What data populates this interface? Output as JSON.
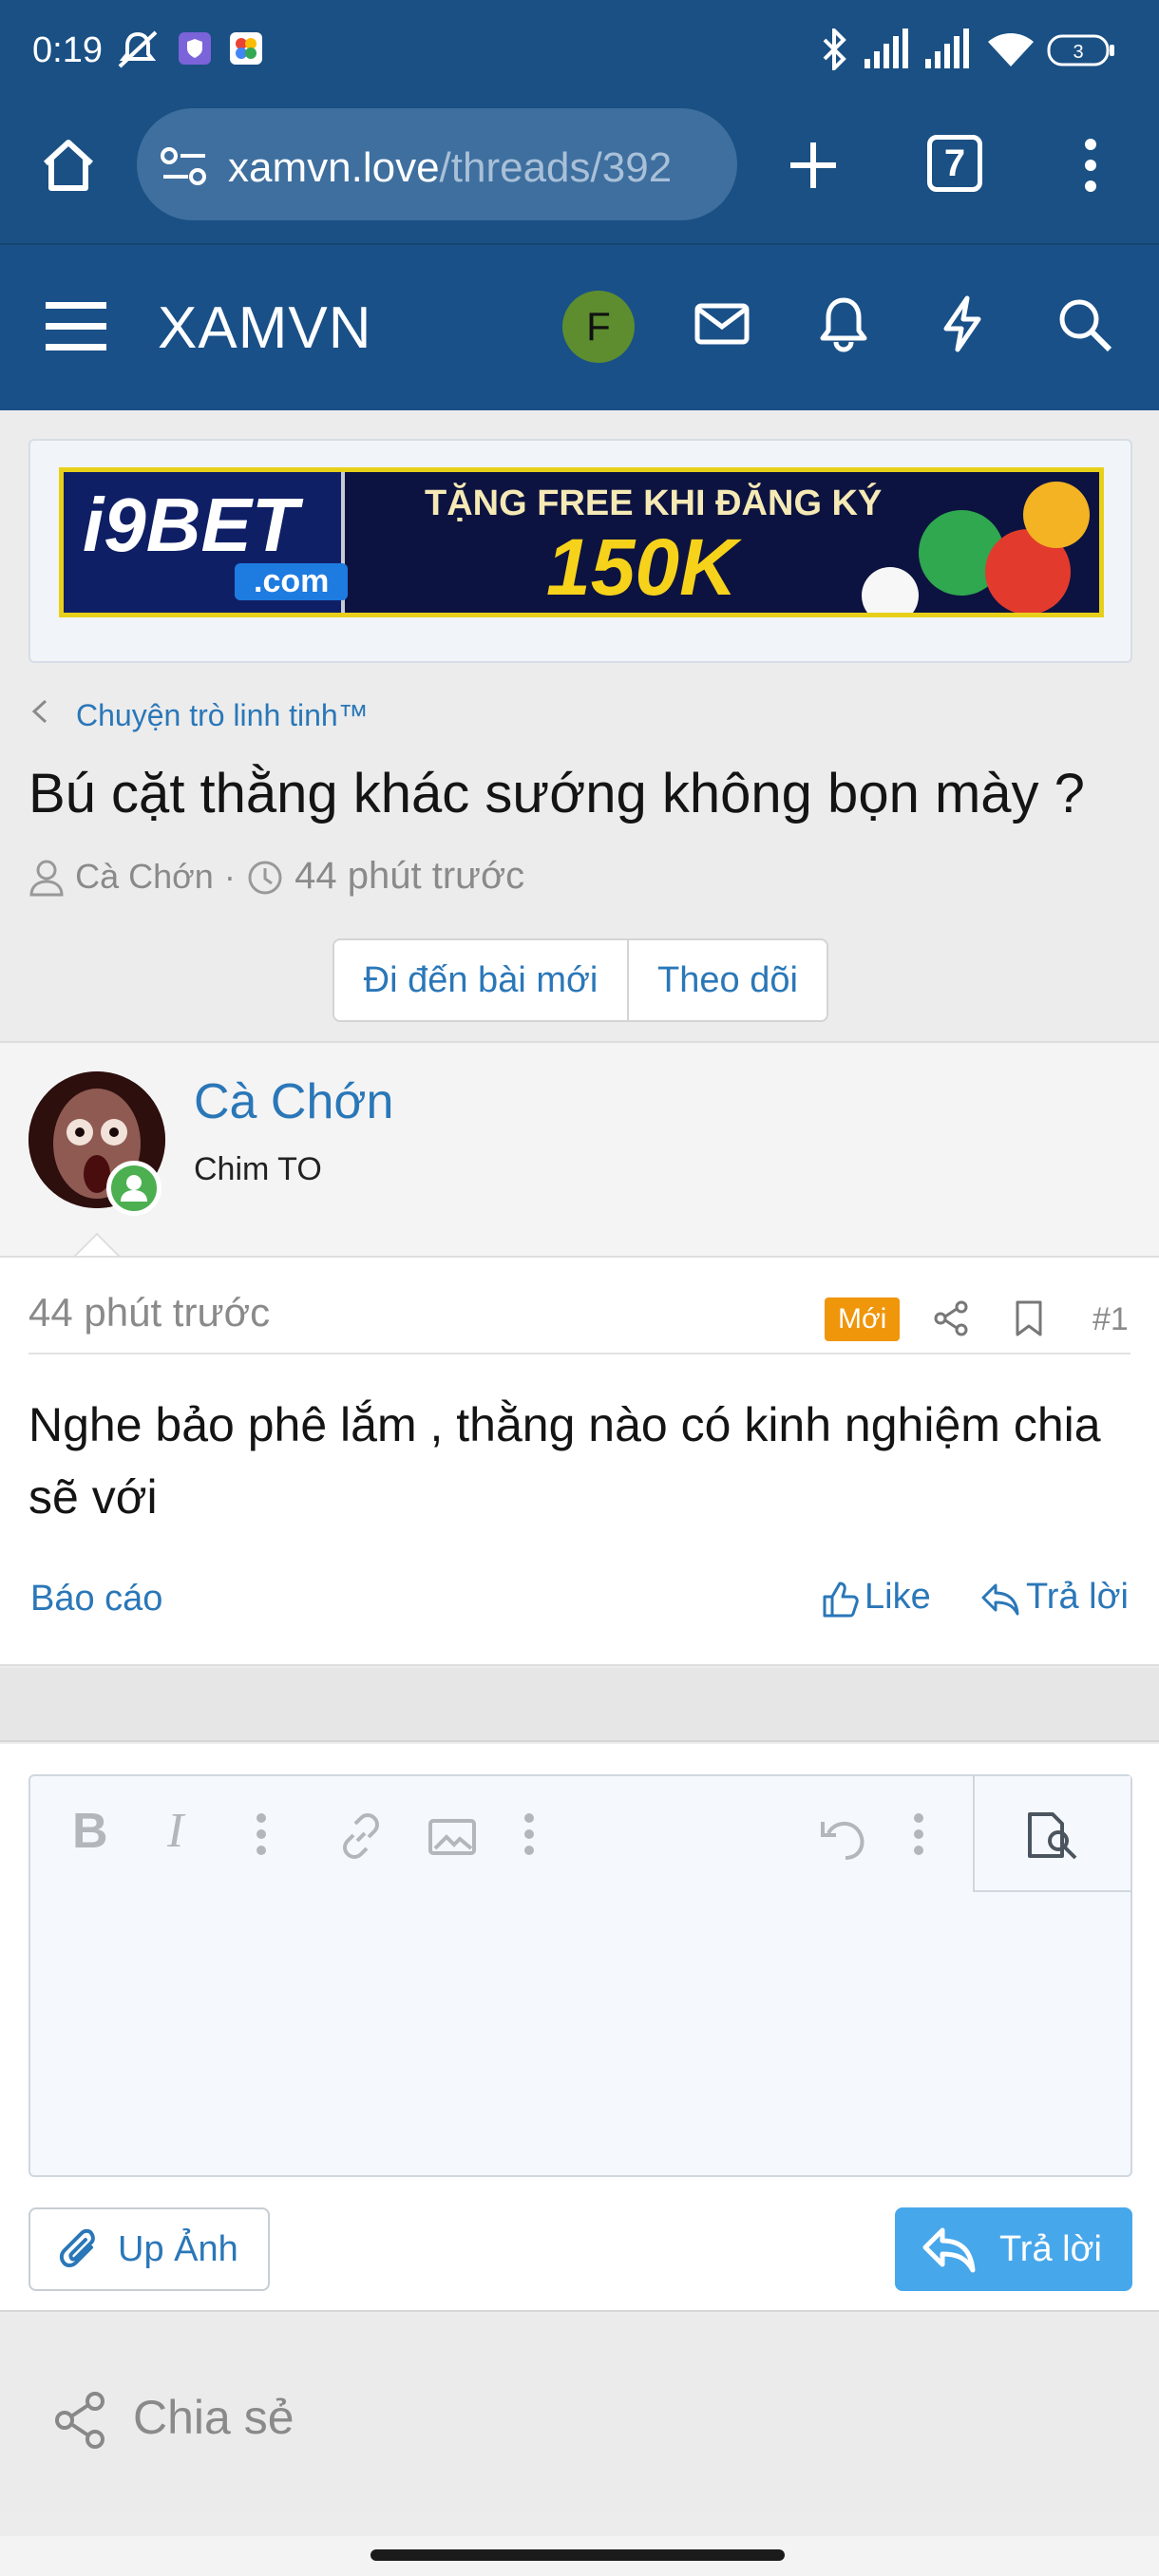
{
  "status_bar": {
    "time": "0:19",
    "battery": "3",
    "icons": [
      "notifications-off-icon",
      "shield-app-icon",
      "pinwheel-app-icon",
      "bluetooth-icon",
      "signal-icon",
      "signal-icon",
      "wifi-icon",
      "battery-icon"
    ]
  },
  "browser": {
    "url_domain": "xamvn.love",
    "url_path": "/threads/392",
    "tab_count": "7"
  },
  "site": {
    "logo": "XAMVN",
    "user_initial": "F",
    "header_color": "#195088"
  },
  "ad": {
    "brand": "i9BET",
    "brand_suffix": ".com",
    "headline": "TẶNG FREE KHI ĐĂNG KÝ",
    "amount": "150K"
  },
  "thread": {
    "breadcrumb": "Chuyện trò linh tinh™",
    "title": "Bú cặt thằng khác sướng không bọn mày ?",
    "author": "Cà Chớn",
    "separator": "·",
    "time": "44 phút trước",
    "buttons": {
      "go_to_new": "Đi đến bài mới",
      "follow": "Theo dõi"
    }
  },
  "post": {
    "author": "Cà Chớn",
    "role": "Chim TO",
    "time": "44 phút trước",
    "badge": "Mới",
    "number": "#1",
    "content": "Nghe bảo phê lắm , thằng nào có kinh nghiệm chia sẽ với",
    "report": "Báo cáo",
    "like": "Like",
    "reply": "Trả lời"
  },
  "editor": {
    "bold": "B",
    "italic": "I",
    "upload_button": "Up Ảnh",
    "submit_button": "Trả lời"
  },
  "share": {
    "label": "Chia sẻ"
  }
}
